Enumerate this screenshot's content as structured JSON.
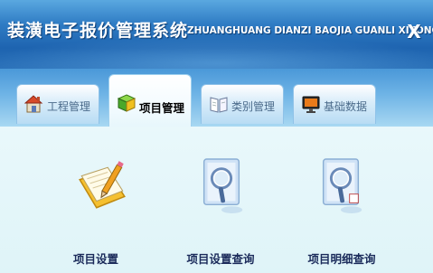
{
  "header": {
    "title": "装潢电子报价管理系统",
    "subtitle": "ZHUANGHUANG DIANZI BAOJIA GUANLI XITONG",
    "close_label": "X"
  },
  "tabs": [
    {
      "label": "工程管理",
      "icon": "house-icon",
      "active": false
    },
    {
      "label": "项目管理",
      "icon": "cube-icon",
      "active": true
    },
    {
      "label": "类别管理",
      "icon": "book-icon",
      "active": false
    },
    {
      "label": "基础数据",
      "icon": "monitor-icon",
      "active": false
    }
  ],
  "items": [
    {
      "label": "项目设置",
      "icon": "pencil-notebook-icon"
    },
    {
      "label": "项目设置查询",
      "icon": "magnifier-document-icon"
    },
    {
      "label": "项目明细查询",
      "icon": "magnifier-document-icon"
    }
  ],
  "colors": {
    "header_dark": "#1e64b0",
    "header_light": "#5aa8e0",
    "content_bg": "#dff4f8",
    "item_label": "#1a2a5a"
  }
}
